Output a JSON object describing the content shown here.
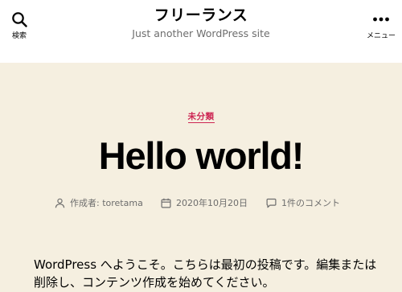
{
  "header": {
    "search_label": "検索",
    "site_title": "フリーランス",
    "site_description": "Just another WordPress site",
    "menu_label": "メニュー"
  },
  "post": {
    "category": "未分類",
    "title": "Hello world!",
    "meta": {
      "author": "作成者: toretama",
      "date": "2020年10月20日",
      "comments": "1件のコメント"
    },
    "content": "WordPress へようこそ。こちらは最初の投稿です。編集または削除し、コンテンツ作成を始めてください。"
  },
  "colors": {
    "accent": "#cd2653",
    "background": "#f5efe0",
    "header_bg": "#ffffff",
    "secondary_text": "#6d6d6d"
  },
  "icons": [
    "search-icon",
    "ellipsis-icon",
    "user-icon",
    "calendar-icon",
    "comment-icon"
  ]
}
